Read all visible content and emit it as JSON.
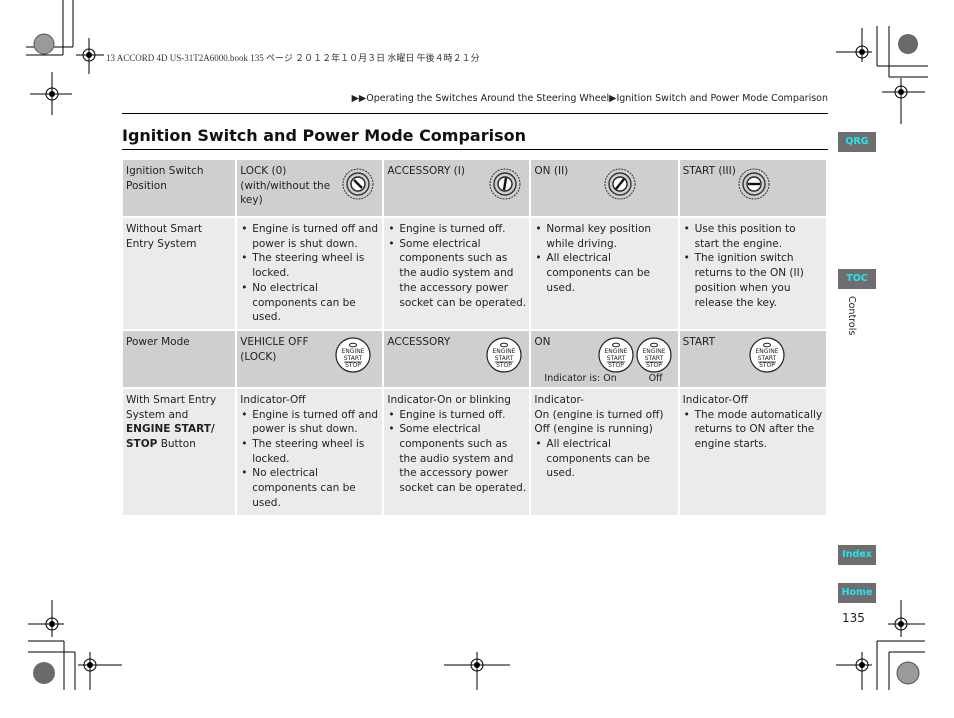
{
  "print_info": "13 ACCORD 4D US-31T2A6000.book  135 ページ  ２０１２年１０月３日  水曜日  午後４時２１分",
  "breadcrumb": {
    "prefix": "▶▶",
    "parent": "Operating the Switches Around the Steering Wheel",
    "separator": "▶",
    "current": "Ignition Switch and Power Mode Comparison"
  },
  "title": "Ignition Switch and Power Mode Comparison",
  "table": {
    "ignition_header": {
      "label": "Ignition Switch Position",
      "cols": [
        "LOCK (0) (with/without the key)",
        "ACCESSORY (I)",
        "ON (II)",
        "START (III)"
      ],
      "icons": [
        "key-lock-icon",
        "key-accessory-icon",
        "key-on-icon",
        "key-start-icon"
      ]
    },
    "without_smart_entry": {
      "label": "Without Smart Entry System",
      "cols": [
        [
          "Engine is turned off and power is shut down.",
          "The steering wheel is locked.",
          "No electrical components can be used."
        ],
        [
          "Engine is turned off.",
          "Some electrical components such as the audio system and the accessory power socket can be operated."
        ],
        [
          "Normal key position while driving.",
          "All electrical components can be used."
        ],
        [
          "Use this position to start the engine.",
          "The ignition switch returns to the ON (II) position when you release the key."
        ]
      ]
    },
    "power_mode_header": {
      "label": "Power Mode",
      "cols": [
        "VEHICLE OFF (LOCK)",
        "ACCESSORY",
        "ON",
        "START"
      ],
      "button_text": [
        "ENGINE",
        "START",
        "STOP"
      ],
      "indicator_label": "Indicator is: On",
      "indicator_off": "Off"
    },
    "with_smart_entry": {
      "label_pre": "With Smart Entry System and ",
      "label_bold": "ENGINE START/ STOP",
      "label_post": " Button",
      "cols": [
        {
          "lines": [
            "Indicator-Off"
          ],
          "bullets": [
            "Engine is turned off and power is shut down.",
            "The steering wheel is locked.",
            "No electrical components can be used."
          ]
        },
        {
          "lines": [
            "Indicator-On or blinking"
          ],
          "bullets": [
            "Engine is turned off.",
            "Some electrical components such as the audio system and the accessory power socket can be operated."
          ]
        },
        {
          "lines": [
            "Indicator-",
            "On (engine is turned off)",
            "Off (engine is running)"
          ],
          "bullets": [
            "All electrical components can be used."
          ]
        },
        {
          "lines": [
            "Indicator-Off"
          ],
          "bullets": [
            "The mode automatically returns to ON after the engine starts."
          ]
        }
      ]
    }
  },
  "side_nav": {
    "qrg": "QRG",
    "toc": "TOC",
    "section": "Controls",
    "index": "Index",
    "home": "Home"
  },
  "page_number": "135",
  "colors": {
    "tab_bg": "#6e6e6e",
    "tab_text": "#21e6ee",
    "header_row": "#cfcfcf",
    "body_row": "#ebebeb"
  }
}
